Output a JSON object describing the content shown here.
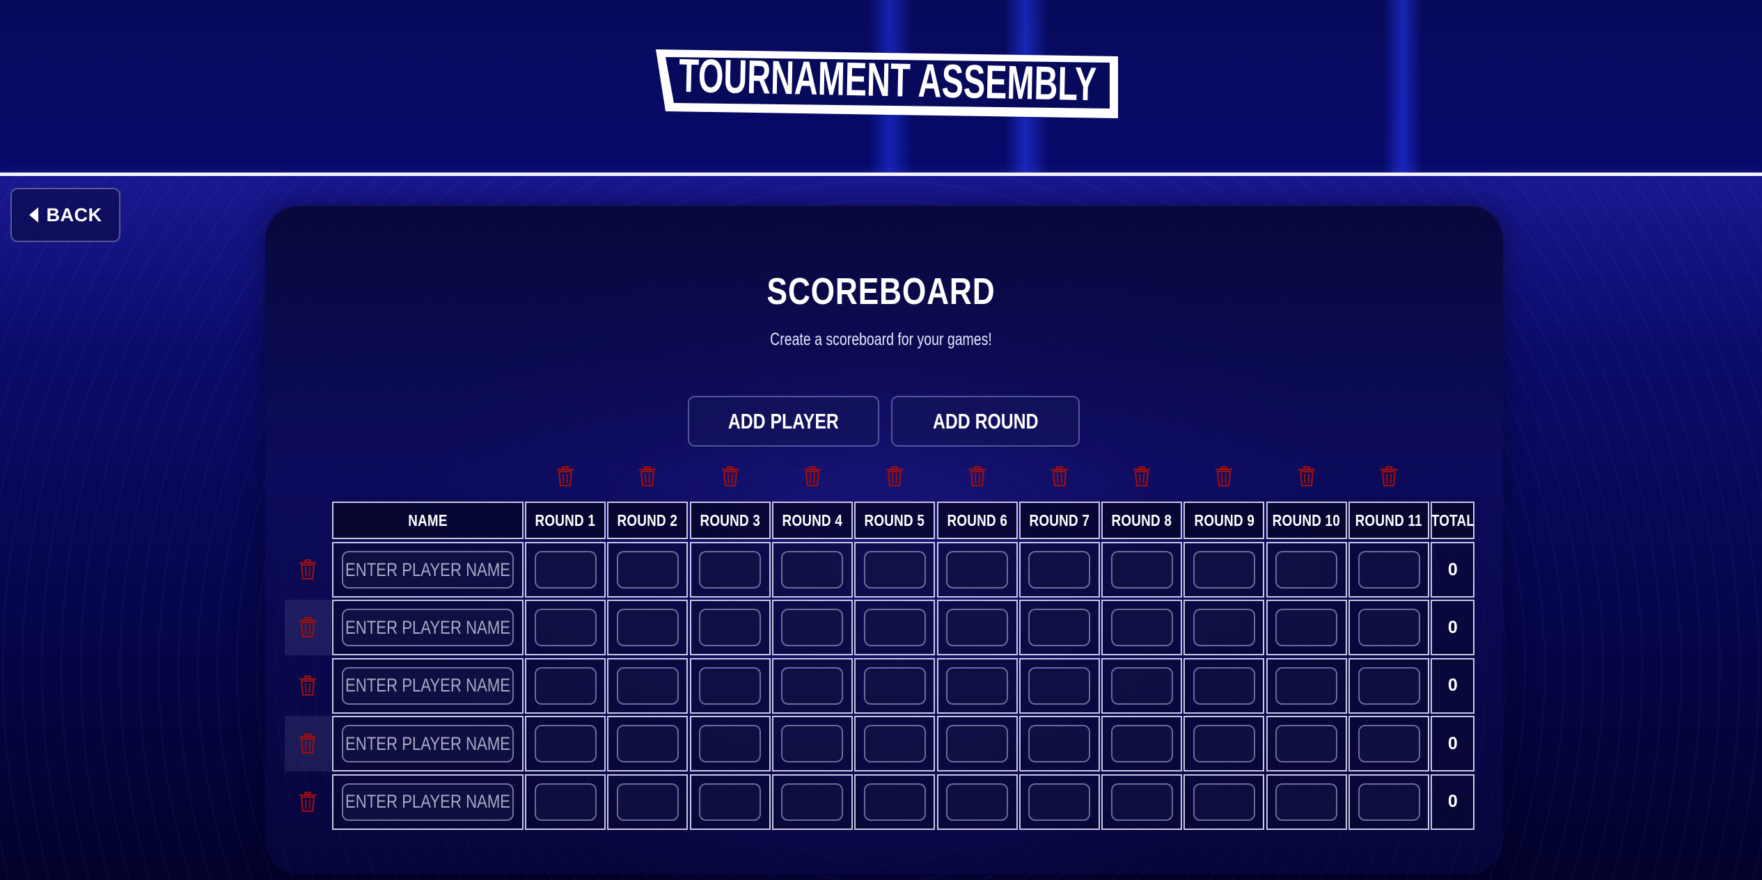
{
  "header": {
    "logo_text": "TOURNAMENT ASSEMBLY"
  },
  "nav": {
    "back_label": "BACK"
  },
  "main": {
    "title": "SCOREBOARD",
    "subtitle": "Create a scoreboard for your games!",
    "add_player_label": "ADD PLAYER",
    "add_round_label": "ADD ROUND"
  },
  "table": {
    "name_header": "NAME",
    "total_header": "TOTAL",
    "rounds": [
      "ROUND 1",
      "ROUND 2",
      "ROUND 3",
      "ROUND 4",
      "ROUND 5",
      "ROUND 6",
      "ROUND 7",
      "ROUND 8",
      "ROUND 9",
      "ROUND 10",
      "ROUND 11"
    ],
    "name_placeholder": "ENTER PLAYER NAME",
    "players": [
      {
        "name": "",
        "total": "0"
      },
      {
        "name": "",
        "total": "0"
      },
      {
        "name": "",
        "total": "0"
      },
      {
        "name": "",
        "total": "0"
      },
      {
        "name": "",
        "total": "0"
      }
    ]
  },
  "colors": {
    "delete_icon": "#9b1010",
    "border": "#ebebff",
    "background": "#0a0a5c"
  },
  "icons": {
    "back": "caret-left-icon",
    "delete": "trash-icon"
  }
}
